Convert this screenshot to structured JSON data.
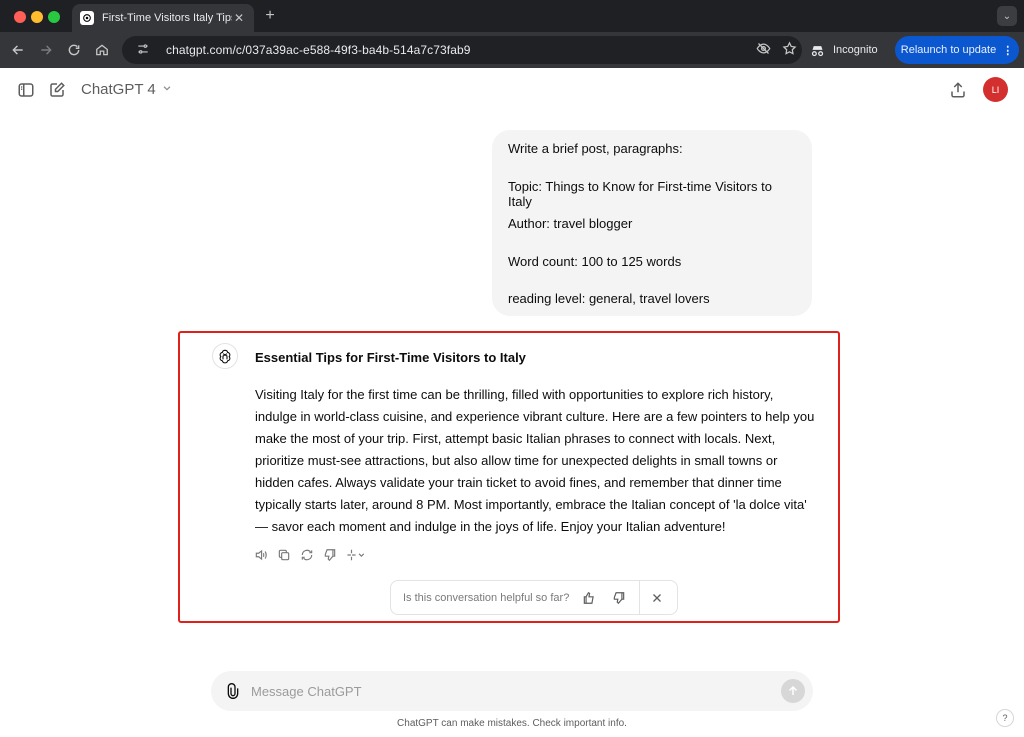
{
  "browser": {
    "tab_title": "First-Time Visitors Italy Tips",
    "tab_close": "✕",
    "new_tab": "+",
    "url": "chatgpt.com/c/037a39ac-e588-49f3-ba4b-514a7c73fab9",
    "incognito_label": "Incognito",
    "relaunch_label": "Relaunch to update"
  },
  "header": {
    "model_name": "ChatGPT 4",
    "avatar_initials": "LI"
  },
  "conversation": {
    "user_message_lines": [
      "Write a brief post, paragraphs:",
      "Topic: Things to Know for First-time Visitors to Italy",
      "Author: travel blogger",
      "Word count: 100 to 125 words",
      "reading level: general, travel lovers"
    ],
    "assistant_title": "Essential Tips for First-Time Visitors to Italy",
    "assistant_body": "Visiting Italy for the first time can be thrilling, filled with opportunities to explore rich history, indulge in world-class cuisine, and experience vibrant culture. Here are a few pointers to help you make the most of your trip. First, attempt basic Italian phrases to connect with locals. Next, prioritize must-see attractions, but also allow time for unexpected delights in small towns or hidden cafes. Always validate your train ticket to avoid fines, and remember that dinner time typically starts later, around 8 PM. Most importantly, embrace the Italian concept of 'la dolce vita' — savor each moment and indulge in the joys of life. Enjoy your Italian adventure!"
  },
  "feedback": {
    "question": "Is this conversation helpful so far?"
  },
  "composer": {
    "placeholder": "Message ChatGPT"
  },
  "footer": {
    "disclaimer": "ChatGPT can make mistakes. Check important info.",
    "help": "?"
  },
  "colors": {
    "highlight_border": "#e0201a",
    "relaunch_button": "#0b57d0",
    "avatar_bg": "#d32f2f"
  }
}
